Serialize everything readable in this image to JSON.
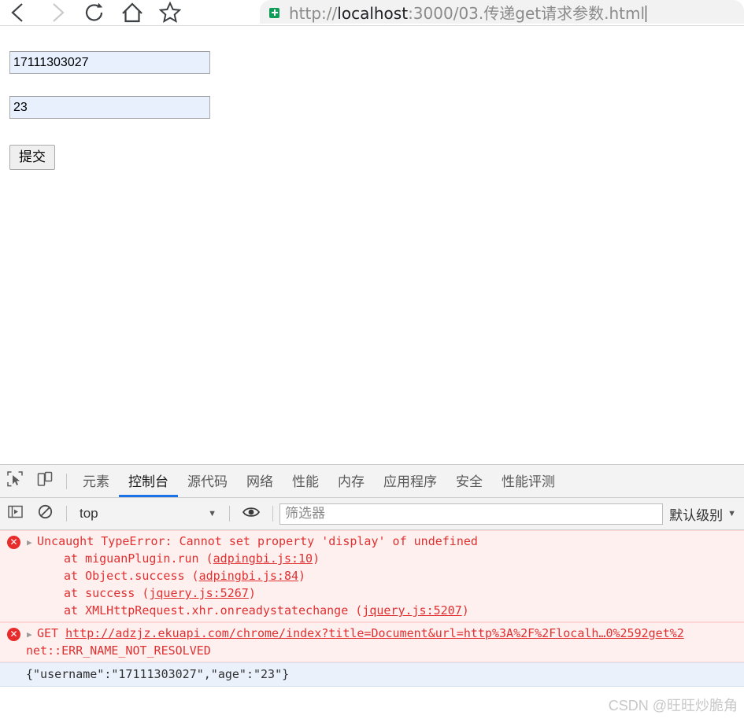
{
  "browser": {
    "nav": {
      "back": "back-arrow",
      "forward": "forward-arrow",
      "reload": "reload-icon",
      "home": "home-icon",
      "bookmark": "star-icon"
    },
    "omnibox": {
      "security_icon": "green-shield-icon",
      "url_scheme": "http://",
      "url_host": "localhost",
      "url_rest": ":3000/03.传递get请求参数.html"
    }
  },
  "page": {
    "username_value": "17111303027",
    "age_value": "23",
    "submit_label": "提交"
  },
  "devtools": {
    "tabs": [
      {
        "label": "元素",
        "active": false
      },
      {
        "label": "控制台",
        "active": true
      },
      {
        "label": "源代码",
        "active": false
      },
      {
        "label": "网络",
        "active": false
      },
      {
        "label": "性能",
        "active": false
      },
      {
        "label": "内存",
        "active": false
      },
      {
        "label": "应用程序",
        "active": false
      },
      {
        "label": "安全",
        "active": false
      },
      {
        "label": "性能评测",
        "active": false
      }
    ],
    "console_toolbar": {
      "context": "top",
      "filter_placeholder": "筛选器",
      "filter_value": "",
      "levels": "默认级别",
      "caret": "▼"
    },
    "messages": {
      "error1": {
        "title": "Uncaught TypeError: Cannot set property 'display' of undefined",
        "stack": [
          {
            "prefix": "at miguanPlugin.run (",
            "link": "adpingbi.js:10",
            "suffix": ")"
          },
          {
            "prefix": "at Object.success (",
            "link": "adpingbi.js:84",
            "suffix": ")"
          },
          {
            "prefix": "at success (",
            "link": "jquery.js:5267",
            "suffix": ")"
          },
          {
            "prefix": "at XMLHttpRequest.xhr.onreadystatechange (",
            "link": "jquery.js:5207",
            "suffix": ")"
          }
        ]
      },
      "error2": {
        "method": "GET",
        "url": "http://adzjz.ekuapi.com/chrome/index?title=Document&url=http%3A%2F%2Flocalh…0%2592get%2",
        "detail": "net::ERR_NAME_NOT_RESOLVED"
      },
      "log1": "{\"username\":\"17111303027\",\"age\":\"23\"}"
    },
    "prompt": ">",
    "watermark": "CSDN @旺旺炒脆角"
  },
  "colors": {
    "accent": "#1a73e8",
    "error": "#e03030",
    "autofill": "#e8f0fe",
    "shield_green": "#0f9d58"
  }
}
